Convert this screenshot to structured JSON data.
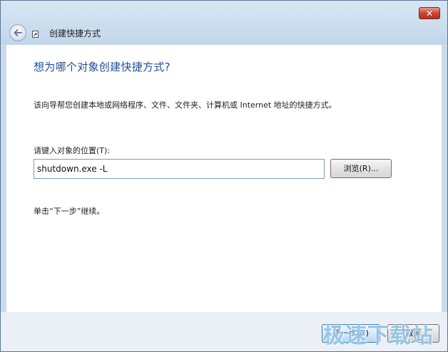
{
  "window": {
    "title": "创建快捷方式",
    "close_label": "✕"
  },
  "content": {
    "heading": "想为哪个对象创建快捷方式?",
    "description": "该向导帮您创建本地或网络程序、文件、文件夹、计算机或 Internet 地址的快捷方式。",
    "location_label": "请键入对象的位置(T):",
    "location_value": "shutdown.exe -L",
    "browse_label": "浏览(R)...",
    "hint": "单击“下一步”继续。"
  },
  "footer": {
    "next_label": "下一步(N)",
    "cancel_label": "取消"
  },
  "watermark": "极速下载站",
  "colors": {
    "heading": "#1f4e9a",
    "titlebar": "#c9dcee",
    "close_button": "#c9402c"
  },
  "icons": [
    "back-arrow-icon",
    "shortcut-icon",
    "close-icon"
  ]
}
